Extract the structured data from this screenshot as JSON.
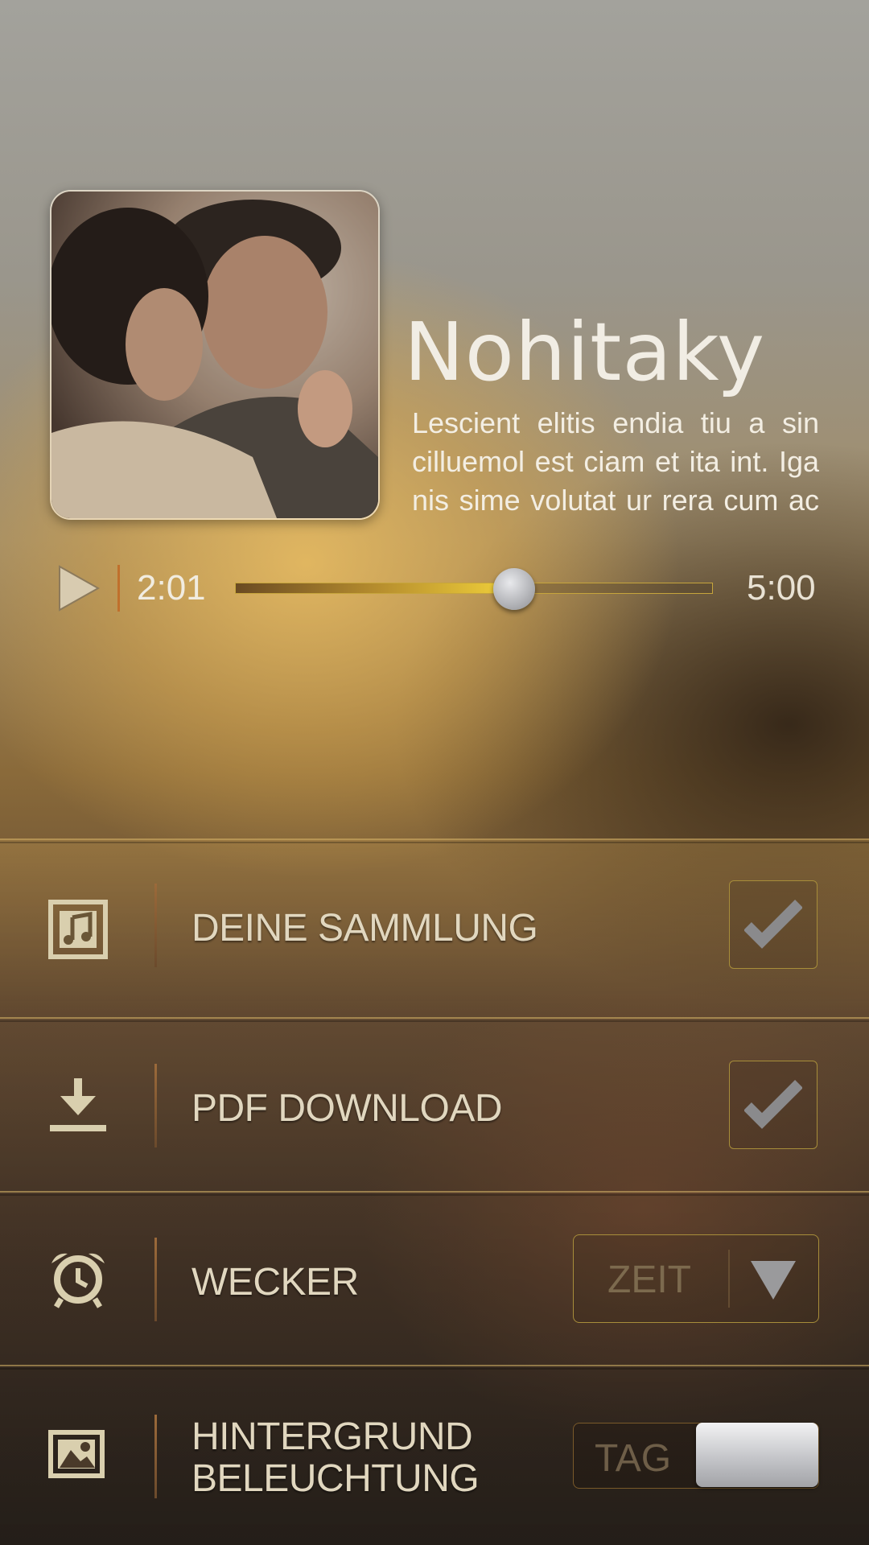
{
  "track": {
    "title": "Nohitaky",
    "description": "Lescient elitis endia tiu a sin cilluemol est ciam et ita int. Iga nis sime volutat ur rera cum ac",
    "album_art": "couple-photo"
  },
  "player": {
    "current_time": "2:01",
    "total_time": "5:00",
    "progress": 0.585,
    "play_icon": "play-icon"
  },
  "settings": {
    "collection": {
      "label": "DEINE SAMMLUNG",
      "icon": "music-note-icon",
      "checked": true
    },
    "pdf": {
      "label": "PDF DOWNLOAD",
      "icon": "download-icon",
      "checked": true
    },
    "alarm": {
      "label": "WECKER",
      "icon": "alarm-clock-icon",
      "dropdown_label": "ZEIT"
    },
    "background": {
      "label_line1": "HINTERGRUND",
      "label_line2": "BELEUCHTUNG",
      "icon": "image-icon",
      "toggle_label": "TAG"
    }
  },
  "colors": {
    "accent_gold": "#f2d23a",
    "divider_orange": "#c0702c",
    "text_light": "#e1d7bf"
  }
}
